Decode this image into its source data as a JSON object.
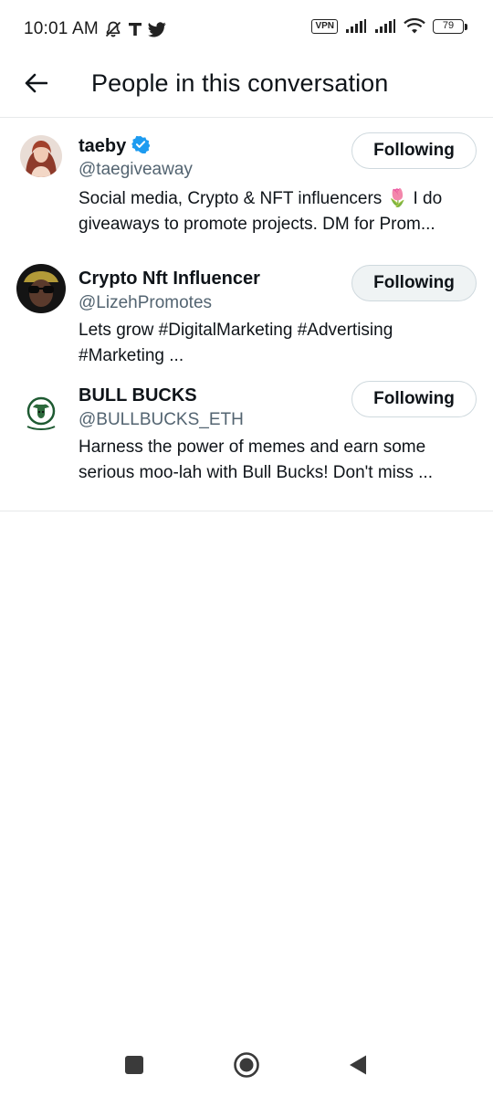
{
  "status_bar": {
    "time": "10:01 AM",
    "left_icons": [
      "bell-muted-icon",
      "t-app-icon",
      "twitter-bird-icon"
    ],
    "vpn_label": "VPN",
    "battery_level": "79",
    "right_icons": [
      "signal-icon",
      "signal-icon",
      "wifi-icon",
      "battery-icon"
    ]
  },
  "header": {
    "title": "People in this conversation",
    "back_icon": "back-arrow-icon"
  },
  "people": [
    {
      "name": "taeby",
      "verified": true,
      "handle": "@taegiveaway",
      "bio_line1": "Social media, Crypto & NFT influencers 🌷 I do",
      "bio_line2": "giveaways to promote projects. DM for Prom...",
      "button_label": "Following"
    },
    {
      "name": "Crypto Nft Influencer",
      "verified": false,
      "handle": "@LizehPromotes",
      "bio_line1": "Lets grow #DigitalMarketing  #Advertising",
      "bio_line2": "#Marketing ...",
      "button_label": "Following"
    },
    {
      "name": "BULL BUCKS",
      "verified": false,
      "handle": "@BULLBUCKS_ETH",
      "bio_line1": "Harness the power of memes and earn some",
      "bio_line2": "serious moo-lah with Bull Bucks! Don't miss ...",
      "button_label": "Following"
    }
  ],
  "colors": {
    "text_primary": "#0f1419",
    "text_secondary": "#536471",
    "verified_blue": "#1d9bf0",
    "divider": "#e7e9ea",
    "button_border": "#cfd9de"
  },
  "nav_bar": {
    "icons": [
      "recents-square-icon",
      "home-circle-icon",
      "back-triangle-icon"
    ]
  }
}
